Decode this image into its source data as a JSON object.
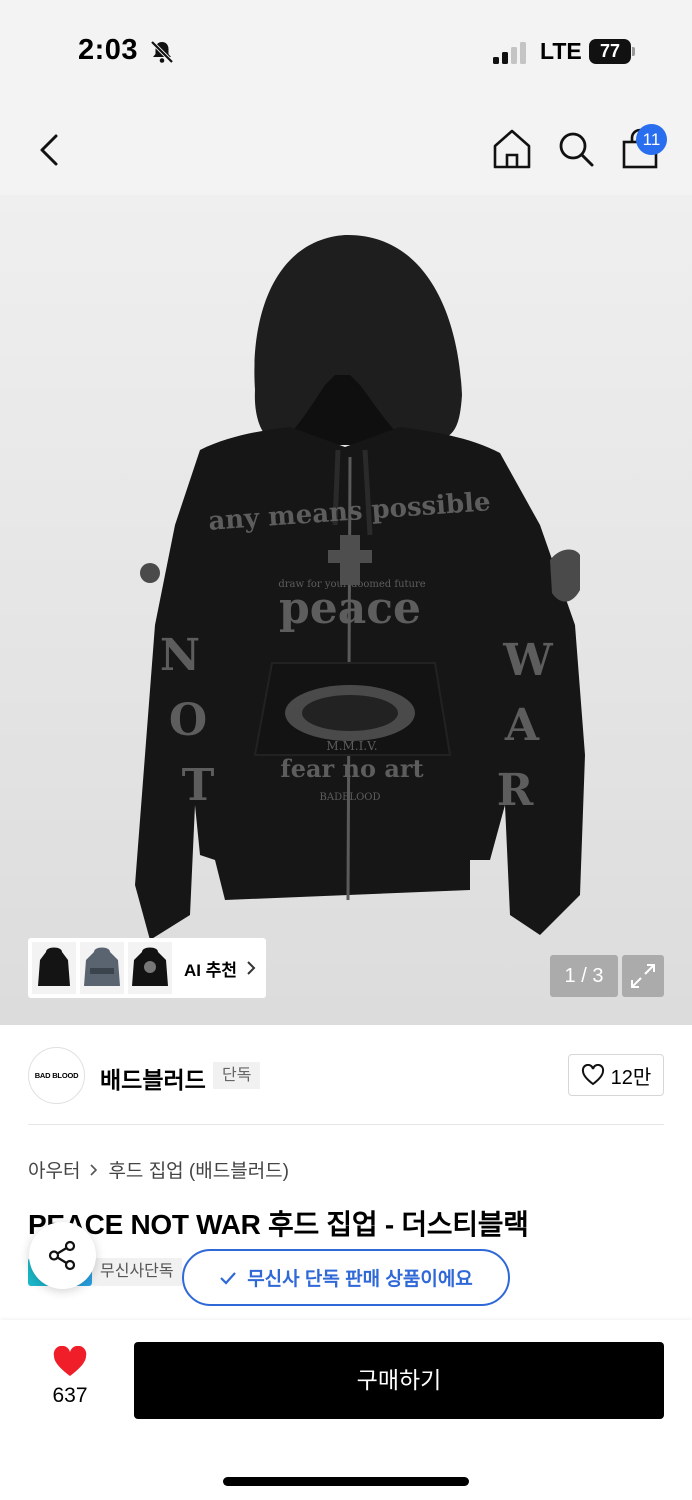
{
  "status": {
    "time": "2:03",
    "network": "LTE",
    "battery": "77",
    "icons": [
      "bell-slash-icon",
      "signal-icon"
    ]
  },
  "nav": {
    "icons": [
      "back-chevron-icon",
      "home-icon",
      "search-icon",
      "shopping-bag-icon"
    ],
    "cart_count": "11"
  },
  "gallery": {
    "counter": "1 / 3",
    "ai_label": "AI 추천",
    "hoodie_print": [
      "any means possible",
      "draw for your doomed future",
      "peace",
      "M.M.I.V.",
      "fear no art",
      "BADBLOOD",
      "N",
      "O",
      "T",
      "W",
      "A",
      "R"
    ]
  },
  "brand": {
    "logo_text": "BAD BLOOD",
    "name": "배드블러드",
    "tag": "단독",
    "likes": "12만"
  },
  "breadcrumb": [
    "아우터",
    "후드 집업 (배드블러드)"
  ],
  "product": {
    "title": "PEACE NOT WAR 후드 집업 - 더스티블랙",
    "exclusive_tag": "무신사단독"
  },
  "toast": {
    "message": "무신사 단독 판매 상품이에요"
  },
  "bottom": {
    "wish_count": "637",
    "buy_label": "구매하기"
  },
  "colors": {
    "accent_blue": "#2a6ef0",
    "toast_blue": "#2f69d8",
    "heart_red": "#f01e28",
    "buy_bg": "#000000"
  }
}
